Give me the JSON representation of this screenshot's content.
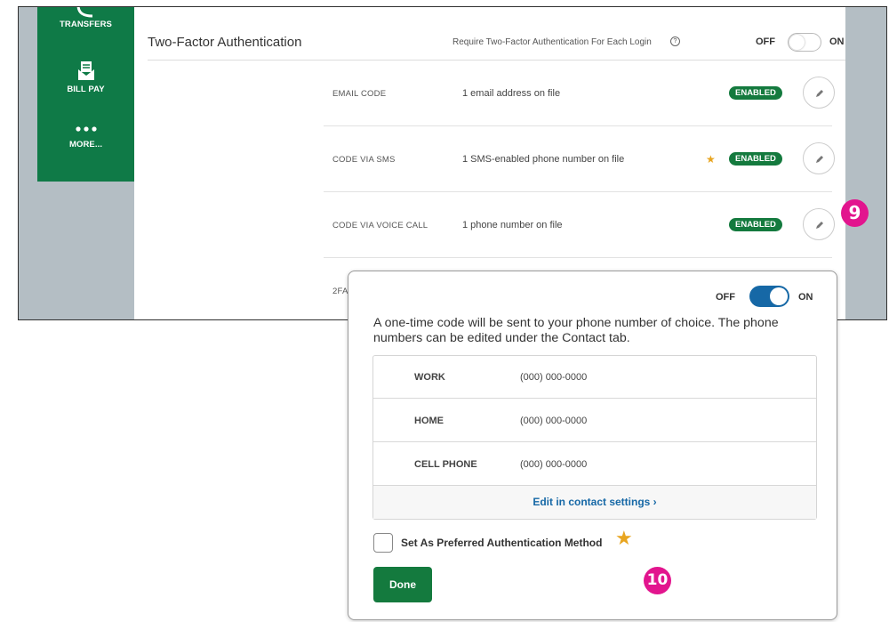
{
  "sidenav": {
    "items": [
      {
        "label": "TRANSFERS",
        "icon": "transfer-arrows-icon"
      },
      {
        "label": "BILL PAY",
        "icon": "envelope-bill-icon"
      },
      {
        "label": "MORE...",
        "icon": "more-dots-icon"
      }
    ]
  },
  "tfa": {
    "title": "Two-Factor Authentication",
    "require_text": "Require Two-Factor Authentication For Each Login",
    "help_glyph": "?",
    "toggle_off_label": "OFF",
    "toggle_on_label": "ON",
    "toggle_state": "off"
  },
  "methods": [
    {
      "name": "EMAIL CODE",
      "desc": "1 email address on file",
      "status": "ENABLED",
      "preferred": false
    },
    {
      "name": "CODE VIA SMS",
      "desc": "1 SMS-enabled phone number on file",
      "status": "ENABLED",
      "preferred": true
    },
    {
      "name": "CODE VIA VOICE CALL",
      "desc": "1 phone number on file",
      "status": "ENABLED",
      "preferred": false
    },
    {
      "name": "2FA",
      "desc": "",
      "status": "",
      "preferred": false
    }
  ],
  "callouts": {
    "first": "9",
    "second": "10"
  },
  "popup": {
    "toggle_off_label": "OFF",
    "toggle_on_label": "ON",
    "toggle_state": "on",
    "description": "A one-time code will be sent to your phone number of choice. The phone numbers can be edited under the Contact tab.",
    "phones": [
      {
        "label": "WORK",
        "number": "(000) 000-0000"
      },
      {
        "label": "HOME",
        "number": "(000) 000-0000"
      },
      {
        "label": "CELL PHONE",
        "number": "(000) 000-0000"
      }
    ],
    "edit_link": "Edit in contact settings ›",
    "preferred_label": "Set As Preferred Authentication Method",
    "preferred_checked": false,
    "done_label": "Done"
  },
  "colors": {
    "brand_green": "#0f7a47",
    "badge_green": "#147a3e",
    "toggle_blue": "#1668a6",
    "star_gold": "#e8a520",
    "callout_pink": "#e2158e"
  }
}
